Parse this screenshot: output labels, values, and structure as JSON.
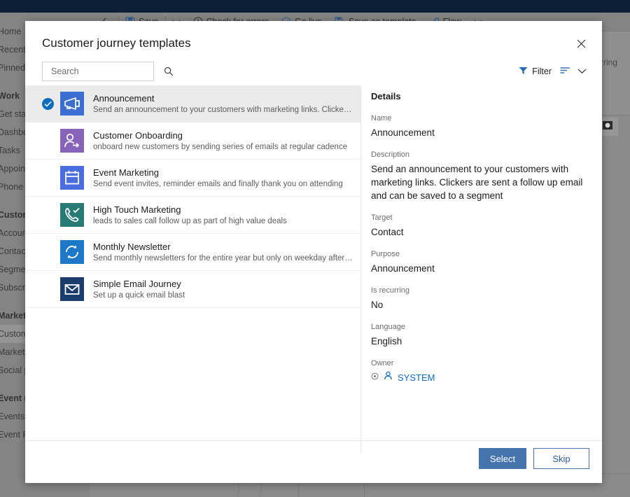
{
  "background": {
    "toolbar": {
      "back_icon": "back-arrow-icon",
      "items": [
        {
          "label": "Save",
          "icon": "save-icon"
        },
        {
          "label": "",
          "icon": "chevron-down-icon"
        },
        {
          "label": "Check for errors",
          "icon": "error-check-icon"
        },
        {
          "label": "Go live",
          "icon": "go-live-icon"
        },
        {
          "label": "Save as template",
          "icon": "save-template-icon"
        },
        {
          "label": "Flow",
          "icon": "flow-icon"
        },
        {
          "label": "",
          "icon": "chevron-down-icon"
        }
      ]
    },
    "sidebar": {
      "items": [
        {
          "label": "Home",
          "type": "item"
        },
        {
          "label": "Recent",
          "type": "item"
        },
        {
          "label": "Pinned",
          "type": "item"
        },
        {
          "label": "Work",
          "type": "header"
        },
        {
          "label": "Get started",
          "type": "item"
        },
        {
          "label": "Dashboards",
          "type": "item"
        },
        {
          "label": "Tasks",
          "type": "item"
        },
        {
          "label": "Appointments",
          "type": "item"
        },
        {
          "label": "Phone Calls",
          "type": "item"
        },
        {
          "label": "Customers",
          "type": "header"
        },
        {
          "label": "Accounts",
          "type": "item"
        },
        {
          "label": "Contacts",
          "type": "item"
        },
        {
          "label": "Segments",
          "type": "item"
        },
        {
          "label": "Subscription lists",
          "type": "item"
        },
        {
          "label": "Marketing execution",
          "type": "header"
        },
        {
          "label": "Customer journeys",
          "type": "item",
          "active": true
        },
        {
          "label": "Marketing emails",
          "type": "item"
        },
        {
          "label": "Social posts",
          "type": "item"
        },
        {
          "label": "Event management",
          "type": "header"
        },
        {
          "label": "Events",
          "type": "item"
        },
        {
          "label": "Event Registrations",
          "type": "item"
        }
      ]
    },
    "canvas_card_text": "recurring",
    "canvas_tile_icon": "image-placeholder-icon"
  },
  "dialog": {
    "title": "Customer journey templates",
    "close_icon": "close-icon",
    "search": {
      "placeholder": "Search",
      "value": "",
      "icon": "search-icon"
    },
    "filter": {
      "label": "Filter",
      "icon": "filter-funnel-icon",
      "sort_icon": "sort-lines-icon",
      "chevron_icon": "chevron-down-icon"
    },
    "templates": [
      {
        "name": "Announcement",
        "description": "Send an announcement to your customers with marketing links. Clickers are sent a...",
        "icon": "megaphone-icon",
        "icon_color": "#3a6ed0",
        "selected": true
      },
      {
        "name": "Customer Onboarding",
        "description": "onboard new customers by sending series of emails at regular cadence",
        "icon": "person-arrow-icon",
        "icon_color": "#8764b8",
        "selected": false
      },
      {
        "name": "Event Marketing",
        "description": "Send event invites, reminder emails and finally thank you on attending",
        "icon": "calendar-icon",
        "icon_color": "#4a6ee0",
        "selected": false
      },
      {
        "name": "High Touch Marketing",
        "description": "leads to sales call follow up as part of high value deals",
        "icon": "phone-check-icon",
        "icon_color": "#287b74",
        "selected": false
      },
      {
        "name": "Monthly Newsletter",
        "description": "Send monthly newsletters for the entire year but only on weekday afternoons",
        "icon": "refresh-cycle-icon",
        "icon_color": "#1e78c8",
        "selected": false
      },
      {
        "name": "Simple Email Journey",
        "description": "Set up a quick email blast",
        "icon": "envelope-icon",
        "icon_color": "#1a3d6d",
        "selected": false
      }
    ],
    "details": {
      "heading": "Details",
      "fields": [
        {
          "label": "Name",
          "value": "Announcement"
        },
        {
          "label": "Description",
          "value": "Send an announcement to your customers with marketing links. Clickers are sent a follow up email and can be saved to a segment"
        },
        {
          "label": "Target",
          "value": "Contact"
        },
        {
          "label": "Purpose",
          "value": "Announcement"
        },
        {
          "label": "Is recurring",
          "value": "No"
        },
        {
          "label": "Language",
          "value": "English"
        }
      ],
      "owner": {
        "label": "Owner",
        "name": "SYSTEM",
        "status_icon": "presence-icon",
        "person_icon": "person-icon"
      }
    },
    "footer": {
      "select_label": "Select",
      "skip_label": "Skip"
    }
  },
  "colors": {
    "accent": "#0f6cbd",
    "primary_button": "#4674ad",
    "selected_row": "#ebebeb"
  }
}
